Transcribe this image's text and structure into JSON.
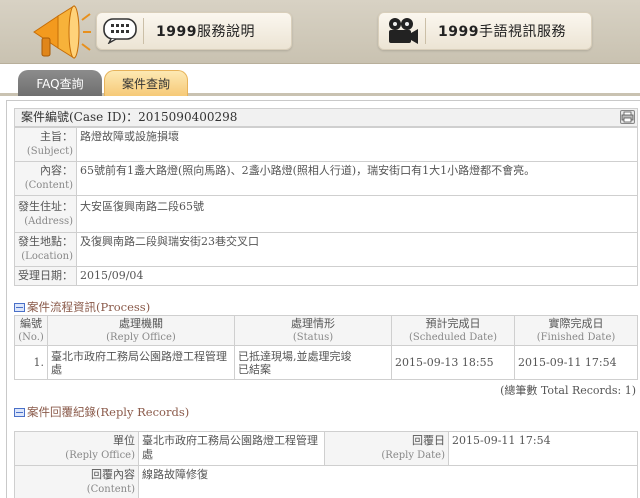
{
  "header": {
    "btn1": {
      "num": "1999",
      "text": "服務說明",
      "icon": "keypad-icon"
    },
    "btn2": {
      "num": "1999",
      "text": "手語視訊服務",
      "icon": "video-camera-icon"
    }
  },
  "tabs": [
    {
      "label": "FAQ查詢",
      "active": false
    },
    {
      "label": "案件查詢",
      "active": true
    }
  ],
  "case": {
    "heading": "案件編號(Case  ID)：2015090400298",
    "rows": [
      {
        "zh": "主旨：",
        "en": "(Subject)",
        "value": "路燈故障或設施損壞"
      },
      {
        "zh": "內容：",
        "en": "(Content)",
        "value": "65號前有1盞大路燈(照向馬路)、2盞小路燈(照相人行道)，瑞安街口有1大1小路燈都不會亮。"
      },
      {
        "zh": "發生住址：",
        "en": "(Address)",
        "value": "大安區復興南路二段65號"
      },
      {
        "zh": "發生地點：",
        "en": "(Location)",
        "value": "及復興南路二段與瑞安街23巷交叉口"
      },
      {
        "zh": "受理日期：",
        "en": "",
        "value": "2015/09/04"
      }
    ]
  },
  "process": {
    "title": "案件流程資訊(Process)",
    "columns": [
      {
        "zh": "編號",
        "en": "(No.)"
      },
      {
        "zh": "處理機關",
        "en": "(Reply Office)"
      },
      {
        "zh": "處理情形",
        "en": "(Status)"
      },
      {
        "zh": "預計完成日",
        "en": "(Scheduled Date)"
      },
      {
        "zh": "實際完成日",
        "en": "(Finished Date)"
      }
    ],
    "rows": [
      {
        "no": "1.",
        "office": "臺北市政府工務局公園路燈工程管理處",
        "status": "已抵達現場,並處理完竣\n已結案",
        "scheduled": "2015-09-13 18:55",
        "finished": "2015-09-11 17:54"
      }
    ],
    "total": "(總筆數 Total Records: 1)"
  },
  "reply": {
    "title": "案件回覆紀錄(Reply Records)",
    "unit_zh": "單位",
    "unit_en": "(Reply Office)",
    "unit_value": "臺北市政府工務局公園路燈工程管理處",
    "date_zh": "回覆日",
    "date_en": "(Reply Date)",
    "date_value": "2015-09-11 17:54",
    "content_zh": "回覆內容",
    "content_en": "(Content)",
    "content_value": "線路故障修復"
  }
}
